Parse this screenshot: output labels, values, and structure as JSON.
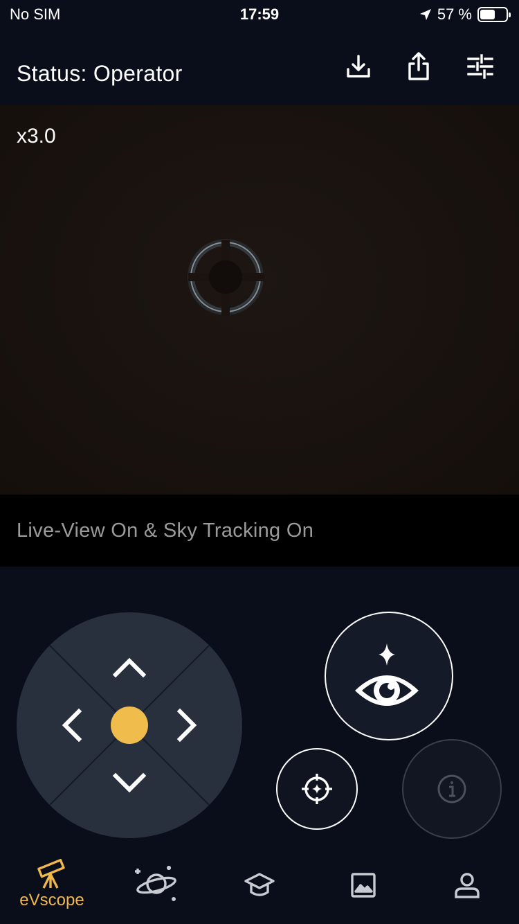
{
  "status_bar": {
    "carrier": "No SIM",
    "time": "17:59",
    "battery_percent_text": "57 %",
    "battery_level": 0.57,
    "icons": [
      "location-arrow-icon",
      "battery-icon"
    ]
  },
  "header": {
    "title": "Status: Operator",
    "actions": [
      {
        "icon": "download-icon"
      },
      {
        "icon": "share-icon"
      },
      {
        "icon": "sliders-icon"
      }
    ]
  },
  "live_view": {
    "zoom": "x3.0"
  },
  "status_strip": {
    "text": "Live-View On & Sky Tracking On"
  },
  "controls": {
    "dpad_icons": [
      "chevron-up-icon",
      "chevron-left-icon",
      "chevron-right-icon",
      "chevron-down-icon"
    ],
    "main_button_icon": "eye-sparkle-icon",
    "center_button_icon": "crosshair-icon",
    "info_button_icon": "info-icon"
  },
  "tabbar": {
    "tabs": [
      {
        "label": "eVscope",
        "icon": "telescope-icon",
        "active": true
      },
      {
        "label": "",
        "icon": "planet-icon",
        "active": false
      },
      {
        "label": "",
        "icon": "graduation-cap-icon",
        "active": false
      },
      {
        "label": "",
        "icon": "image-icon",
        "active": false
      },
      {
        "label": "",
        "icon": "user-icon",
        "active": false
      }
    ]
  },
  "colors": {
    "background": "#0a0e1a",
    "accent": "#f0b84a",
    "dpad": "#28303d",
    "muted_text": "#9b9b9b"
  }
}
